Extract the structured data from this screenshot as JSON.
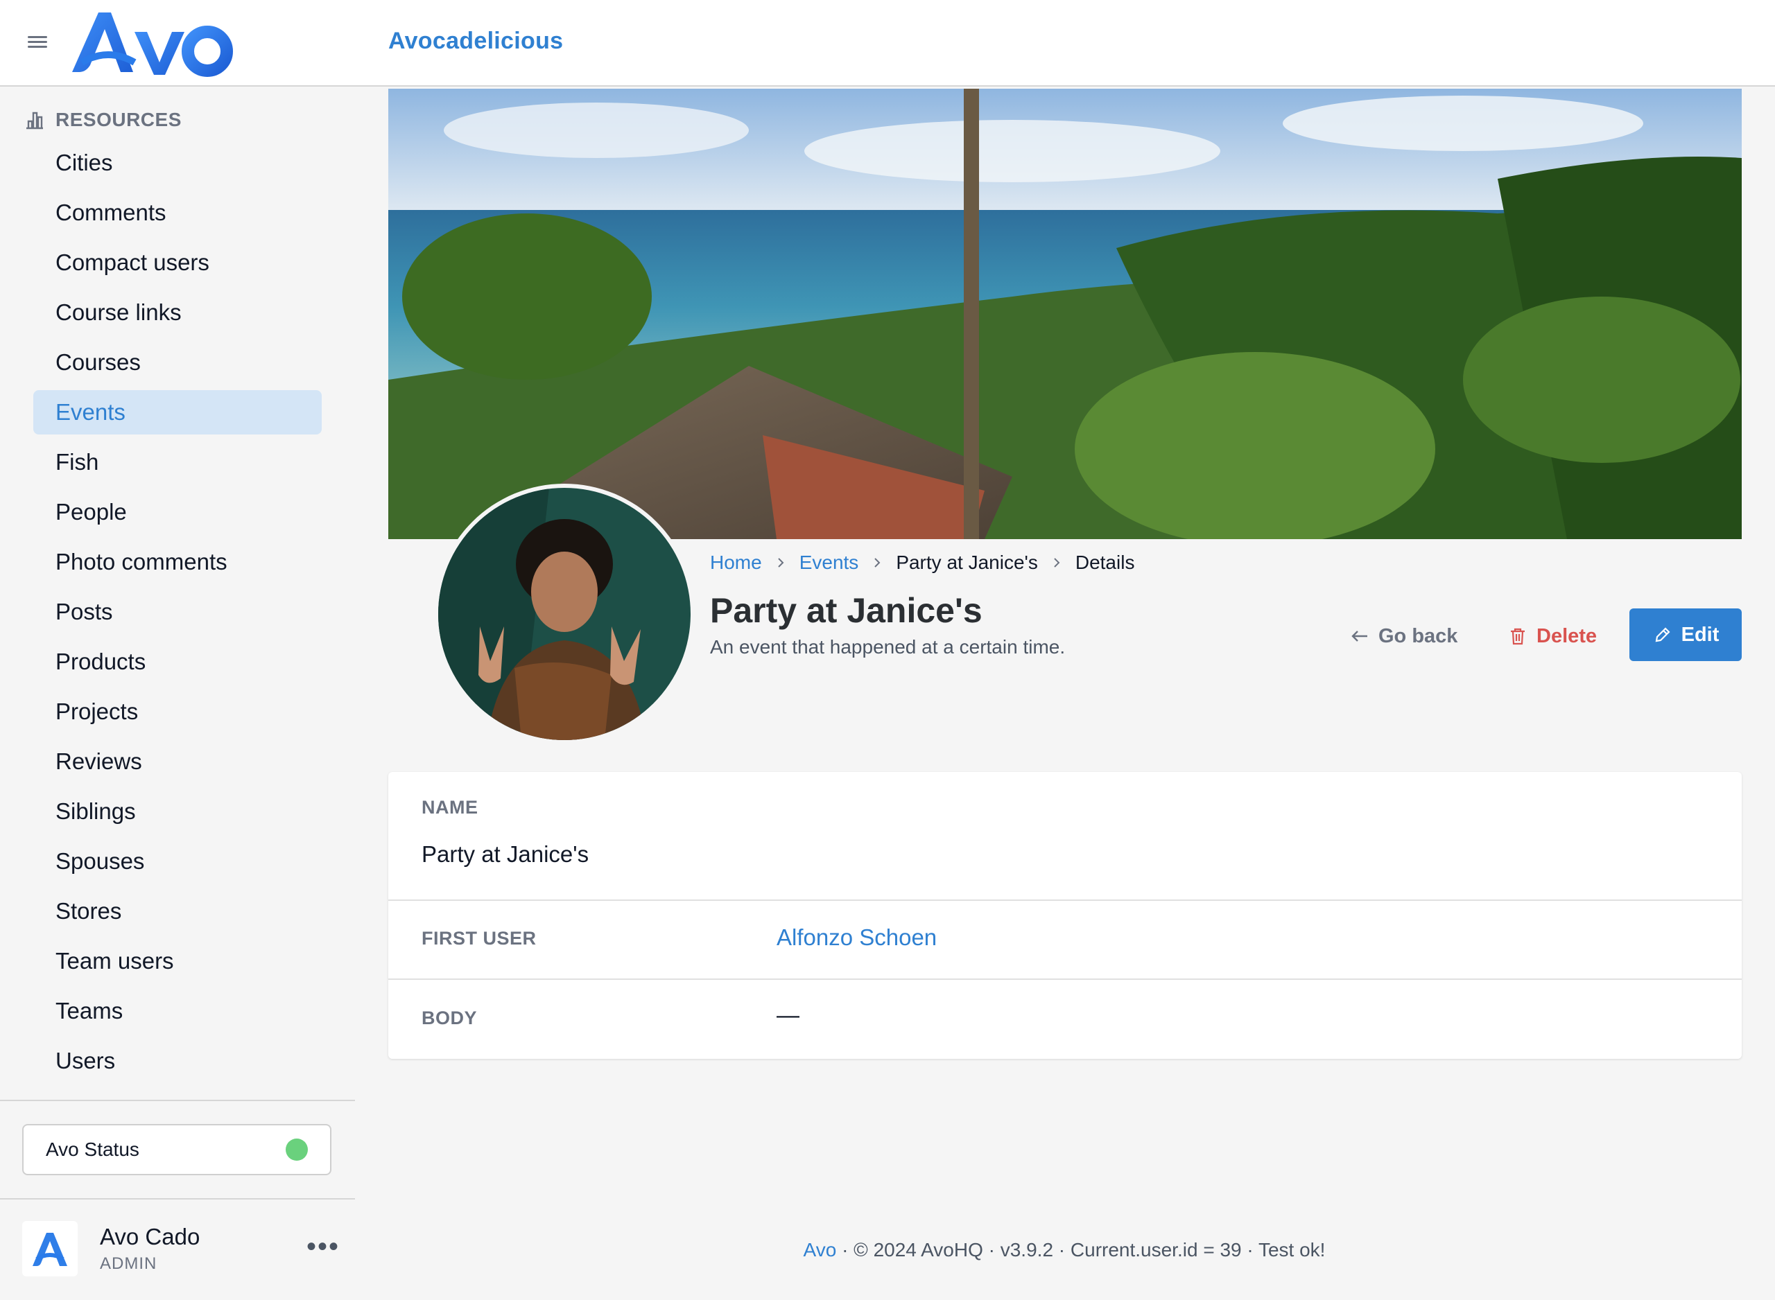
{
  "header": {
    "app_name": "Avocadelicious",
    "logo_alt": "Avo"
  },
  "sidebar": {
    "section_title": "RESOURCES",
    "items": [
      {
        "label": "Cities"
      },
      {
        "label": "Comments"
      },
      {
        "label": "Compact users"
      },
      {
        "label": "Course links"
      },
      {
        "label": "Courses"
      },
      {
        "label": "Events",
        "active": true
      },
      {
        "label": "Fish"
      },
      {
        "label": "People"
      },
      {
        "label": "Photo comments"
      },
      {
        "label": "Posts"
      },
      {
        "label": "Products"
      },
      {
        "label": "Projects"
      },
      {
        "label": "Reviews"
      },
      {
        "label": "Siblings"
      },
      {
        "label": "Spouses"
      },
      {
        "label": "Stores"
      },
      {
        "label": "Team users"
      },
      {
        "label": "Teams"
      },
      {
        "label": "Users"
      }
    ],
    "status": {
      "label": "Avo Status",
      "color": "#6ad17d"
    },
    "user": {
      "name": "Avo Cado",
      "role": "ADMIN"
    }
  },
  "breadcrumb": {
    "home": "Home",
    "events": "Events",
    "record": "Party at Janice's",
    "current": "Details"
  },
  "page": {
    "title": "Party at Janice's",
    "description": "An event that happened at a certain time.",
    "actions": {
      "back": "Go back",
      "delete": "Delete",
      "edit": "Edit"
    }
  },
  "fields": {
    "name": {
      "label": "NAME",
      "value": "Party at Janice's"
    },
    "first_user": {
      "label": "FIRST USER",
      "value": "Alfonzo Schoen"
    },
    "body": {
      "label": "BODY",
      "value": "—"
    }
  },
  "footer": {
    "link": "Avo",
    "text": " · © 2024 AvoHQ · v3.9.2 · Current.user.id = 39 · Test ok!"
  },
  "colors": {
    "accent": "#2f80d1",
    "danger": "#d9534f",
    "active_bg": "#d4e5f6"
  }
}
